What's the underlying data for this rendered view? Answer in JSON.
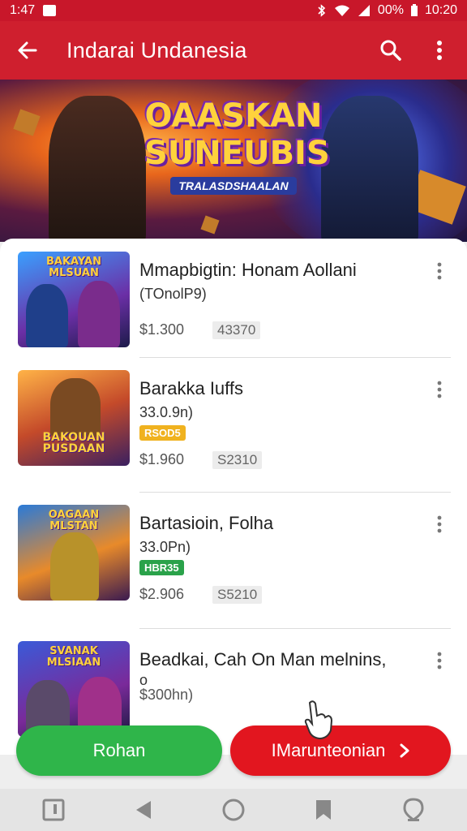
{
  "status_bar": {
    "time": "1:47",
    "battery": "00%",
    "clock": "10:20"
  },
  "app_bar": {
    "title": "Indarai Undanesia"
  },
  "banner": {
    "line1": "OAASKAN",
    "line2": "SUNEUBIS",
    "subtitle": "TRALASDSHAALAN"
  },
  "items": [
    {
      "thumb_title": "BAKAYAN MLSUAN",
      "name": "Mmapbigtin: Honam Aollani",
      "meta": "(TOnolP9)",
      "badge": "",
      "price": "$1.300",
      "tag": "43370"
    },
    {
      "thumb_title": "BAKOUAN PUSDAAN",
      "name": "Barakka Iuffs",
      "meta": "33.0.9n)",
      "badge": "RSOD5",
      "price": "$1.960",
      "tag": "S2310"
    },
    {
      "thumb_title": "OAGAAN MLSTAN",
      "name": "Bartasioin, Folha",
      "meta": "33.0Pn)",
      "badge": "HBR35",
      "price": "$2.906",
      "tag": "S5210"
    },
    {
      "thumb_title": "SVANAK MLSIAAN",
      "name": "Beadkai, Cah On Man melnins,",
      "meta": "o",
      "badge": "",
      "price": "$300hn)",
      "tag": ""
    }
  ],
  "buttons": {
    "left": "Rohan",
    "right": "IMarunteonian"
  },
  "colors": {
    "primary_red": "#cf1f2e",
    "status_red": "#c8172a",
    "green": "#2fb54a",
    "button_red": "#e2161f",
    "badge_yellow": "#f0b21f",
    "badge_green": "#2aa24a"
  }
}
